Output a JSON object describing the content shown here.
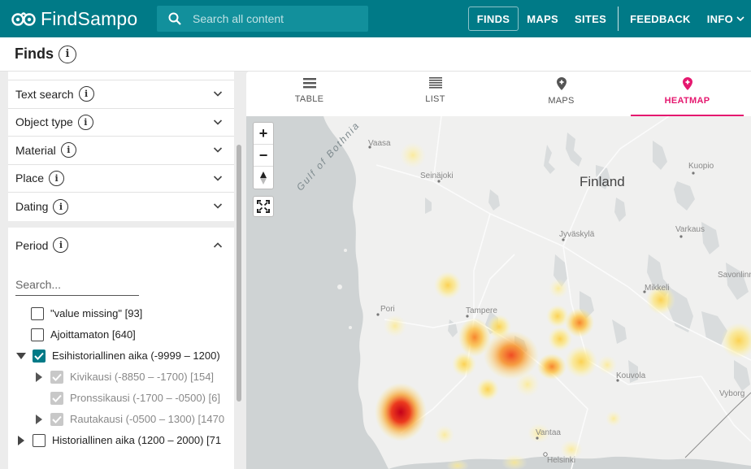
{
  "header": {
    "brand": "FindSampo",
    "search_placeholder": "Search all content",
    "nav": [
      "FINDS",
      "MAPS",
      "SITES",
      "FEEDBACK",
      "INFO"
    ]
  },
  "page": {
    "title": "Finds"
  },
  "facets": [
    {
      "label": "Text search"
    },
    {
      "label": "Object type"
    },
    {
      "label": "Material"
    },
    {
      "label": "Place"
    },
    {
      "label": "Dating"
    }
  ],
  "period": {
    "label": "Period",
    "search_placeholder": "Search...",
    "items": [
      {
        "label": "\"value missing\" [93]"
      },
      {
        "label": "Ajoittamaton [640]"
      },
      {
        "label": "Esihistoriallinen aika (-9999 – 1200)"
      },
      {
        "label": "Kivikausi (-8850 – -1700) [154]"
      },
      {
        "label": "Pronssikausi (-1700 – -0500) [6]"
      },
      {
        "label": "Rautakausi (-0500 – 1300) [1470"
      },
      {
        "label": "Historiallinen aika (1200 – 2000) [71"
      }
    ]
  },
  "tabs": [
    {
      "label": "TABLE",
      "icon": "table-icon"
    },
    {
      "label": "LIST",
      "icon": "list-icon"
    },
    {
      "label": "MAPS",
      "icon": "map-pin-icon"
    },
    {
      "label": "HEATMAP",
      "icon": "heatmap-pin-icon"
    }
  ],
  "map": {
    "labels": {
      "country": "Finland",
      "gulf": "Gulf of Bothnia",
      "cities": [
        "Vaasa",
        "Seinäjoki",
        "Kuopio",
        "Varkaus",
        "Jyväskylä",
        "Savonlinna",
        "Mikkeli",
        "Pori",
        "Tampere",
        "Kouvola",
        "Vyborg",
        "Vantaa",
        "Helsinki"
      ]
    },
    "zoom_in": "+",
    "zoom_out": "−"
  },
  "colors": {
    "topbar": "#007a87",
    "accent": "#e5186f",
    "checkbox": "#007a87"
  }
}
